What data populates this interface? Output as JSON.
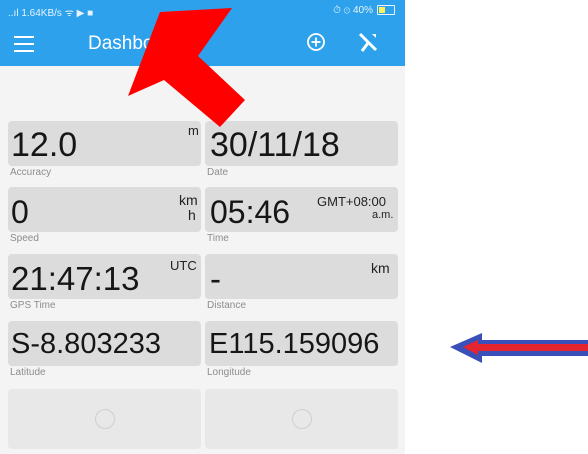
{
  "status_bar": {
    "left": "..ıl 1.64KB/s ᯤ ▶ ■",
    "right": "⏱ ⊙ 40%"
  },
  "app_bar": {
    "title": "Dashboard",
    "menu_icon": "hamburger-menu-icon",
    "add_icon": "add-circle-icon",
    "tool_icon": "tool-icon"
  },
  "cards": {
    "accuracy": {
      "value": "12.0",
      "unit": "m",
      "label": "Accuracy"
    },
    "date": {
      "value": "30/11/18",
      "label": "Date"
    },
    "speed": {
      "value": "0",
      "unit_top": "km",
      "unit_bottom": "h",
      "label": "Speed"
    },
    "time": {
      "value": "05:46",
      "tz": "GMT+08:00",
      "ampm": "a.m.",
      "label": "Time"
    },
    "gps_time": {
      "value": "21:47:13",
      "unit": "UTC",
      "label": "GPS Time"
    },
    "distance": {
      "value": "-",
      "unit": "km",
      "label": "Distance"
    },
    "latitude": {
      "value": "S-8.803233",
      "label": "Latitude"
    },
    "longitude": {
      "value": "E115.159096",
      "label": "Longitude"
    }
  },
  "colors": {
    "app_bar": "#2da1ec",
    "card": "#dcdcdc",
    "annotation_red": "#ff0000",
    "annotation_blue": "#3a4fb8"
  }
}
